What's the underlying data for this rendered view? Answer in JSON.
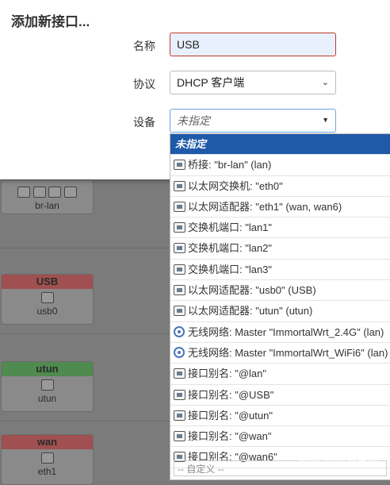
{
  "modal": {
    "title": "添加新接口...",
    "name_label": "名称",
    "name_value": "USB",
    "protocol_label": "协议",
    "protocol_value": "DHCP 客户端",
    "device_label": "设备",
    "device_value": "未指定"
  },
  "dropdown": {
    "items": [
      {
        "label": "未指定",
        "icon": "none"
      },
      {
        "label": "桥接: \"br-lan\" (lan)",
        "icon": "bridge-icon"
      },
      {
        "label": "以太网交换机: \"eth0\"",
        "icon": "switch-icon"
      },
      {
        "label": "以太网适配器: \"eth1\" (wan, wan6)",
        "icon": "ethernet-icon"
      },
      {
        "label": "交换机端口: \"lan1\"",
        "icon": "switch-port-icon"
      },
      {
        "label": "交换机端口: \"lan2\"",
        "icon": "switch-port-icon"
      },
      {
        "label": "交换机端口: \"lan3\"",
        "icon": "switch-port-icon"
      },
      {
        "label": "以太网适配器: \"usb0\" (USB)",
        "icon": "ethernet-icon"
      },
      {
        "label": "以太网适配器: \"utun\" (utun)",
        "icon": "ethernet-icon"
      },
      {
        "label": "无线网络: Master \"ImmortalWrt_2.4G\" (lan)",
        "icon": "wifi-icon"
      },
      {
        "label": "无线网络: Master \"ImmortalWrt_WiFi6\" (lan)",
        "icon": "wifi-icon"
      },
      {
        "label": "接口别名: \"@lan\"",
        "icon": "alias-icon"
      },
      {
        "label": "接口别名: \"@USB\"",
        "icon": "alias-icon"
      },
      {
        "label": "接口别名: \"@utun\"",
        "icon": "alias-icon"
      },
      {
        "label": "接口别名: \"@wan\"",
        "icon": "alias-icon"
      },
      {
        "label": "接口别名: \"@wan6\"",
        "icon": "alias-icon"
      }
    ],
    "custom_placeholder": "-- 自定义 --"
  },
  "background": {
    "lan_card_label": "br-lan",
    "cards": [
      {
        "name": "USB",
        "device": "usb0",
        "color": "#a85050"
      },
      {
        "name": "utun",
        "device": "utun",
        "color": "#4f8a4f"
      },
      {
        "name": "wan",
        "device": "eth1",
        "color": "#a85050"
      }
    ]
  },
  "watermark": "知乎 @隐身登陆"
}
